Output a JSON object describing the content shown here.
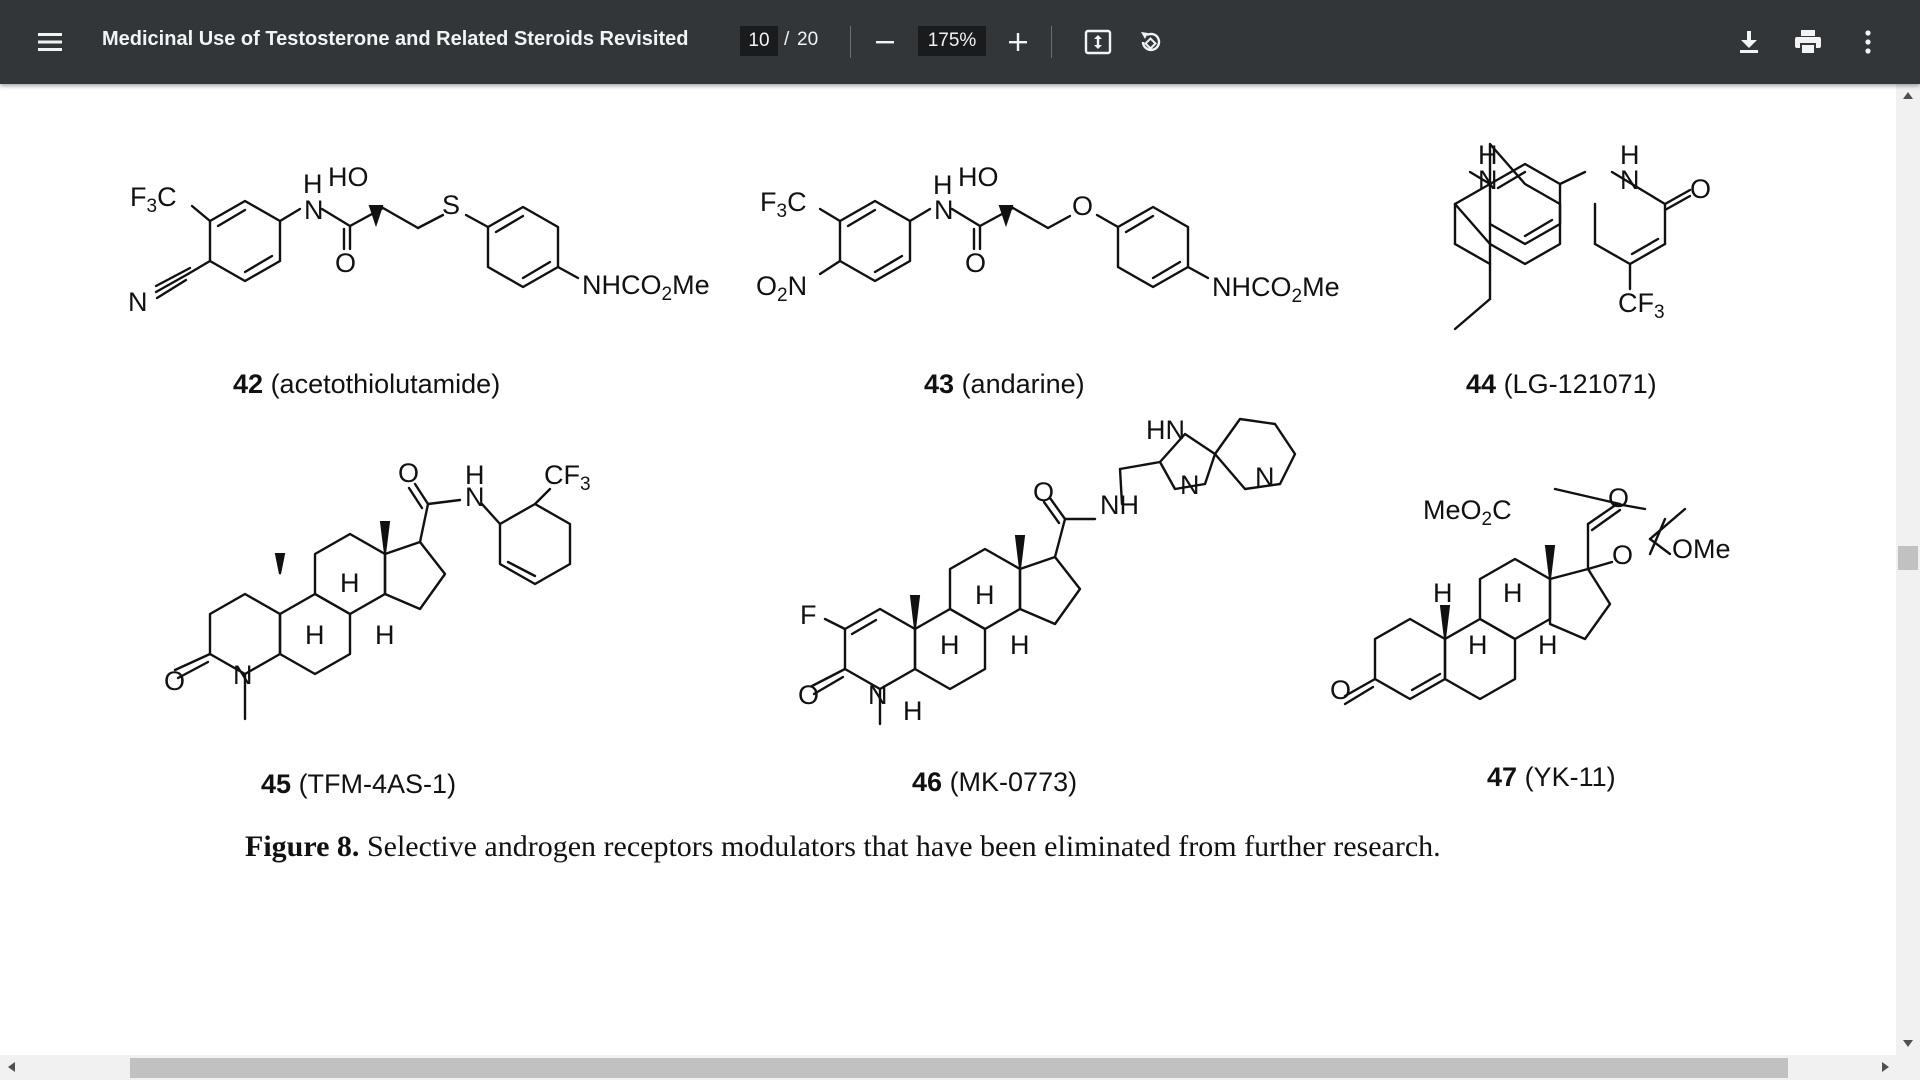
{
  "toolbar": {
    "title": "Medicinal Use of Testosterone and Related Steroids Revisited",
    "page_current": "10",
    "page_separator": "/",
    "page_total": "20",
    "zoom": "175%"
  },
  "icons": {
    "menu": "hamburger-menu-icon",
    "zoom_out": "minus-icon",
    "zoom_in": "plus-icon",
    "fit": "fit-to-page-icon",
    "rotate": "rotate-counterclockwise-icon",
    "download": "download-icon",
    "print": "print-icon",
    "more": "more-vertical-icon"
  },
  "compounds": [
    {
      "number": "42",
      "name": "(acetothiolutamide)"
    },
    {
      "number": "43",
      "name": "(andarine)"
    },
    {
      "number": "44",
      "name": "(LG-121071)"
    },
    {
      "number": "45",
      "name": "(TFM-4AS-1)"
    },
    {
      "number": "46",
      "name": "(MK-0773)"
    },
    {
      "number": "47",
      "name": "(YK-11)"
    }
  ],
  "caption": {
    "label": "Figure 8.",
    "text": " Selective androgen receptors modulators that have been eliminated from further research."
  },
  "colors": {
    "toolbar_bg": "#323639",
    "toolbar_text": "#f1f3f4",
    "page_bg": "#ffffff",
    "scrollbar_track": "#f1f1f1",
    "scrollbar_thumb": "#c1c1c1"
  }
}
